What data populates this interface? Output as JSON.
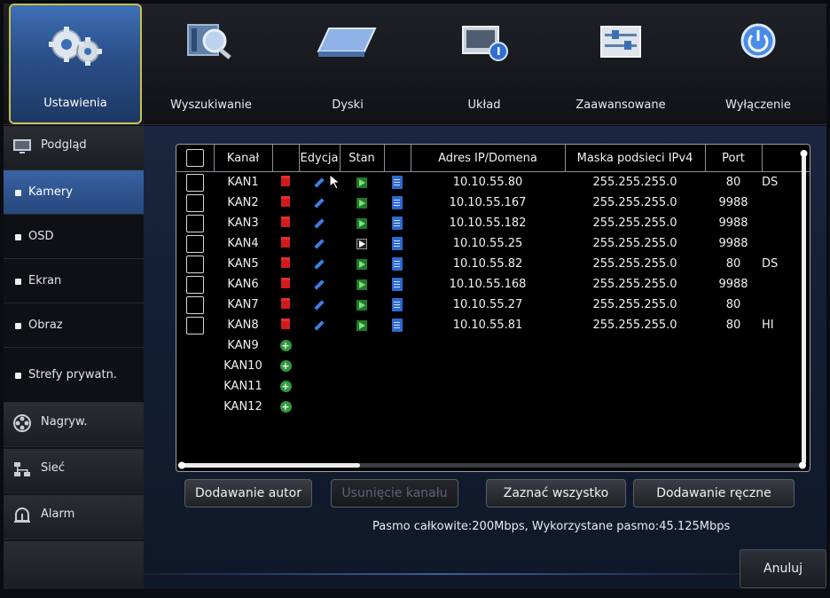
{
  "topnav": [
    {
      "label": "Ustawienia",
      "icon": "settings-gears-icon",
      "active": true
    },
    {
      "label": "Wyszukiwanie",
      "icon": "search-magnifier-icon",
      "active": false
    },
    {
      "label": "Dyski",
      "icon": "hard-disk-icon",
      "active": false
    },
    {
      "label": "Układ",
      "icon": "system-info-icon",
      "active": false
    },
    {
      "label": "Zaawansowane",
      "icon": "advanced-sliders-icon",
      "active": false
    },
    {
      "label": "Wyłączenie",
      "icon": "power-icon",
      "active": false
    }
  ],
  "sidebar": [
    {
      "label": "Podgląd",
      "type": "main",
      "icon": "monitor-icon"
    },
    {
      "label": "Kamery",
      "type": "sub",
      "active": true
    },
    {
      "label": "OSD",
      "type": "sub"
    },
    {
      "label": "Ekran",
      "type": "sub"
    },
    {
      "label": "Obraz",
      "type": "sub"
    },
    {
      "label": "Strefy prywatn.",
      "type": "sub"
    },
    {
      "label": "Nagryw.",
      "type": "main",
      "icon": "film-reel-icon"
    },
    {
      "label": "Sieć",
      "type": "main",
      "icon": "network-icon"
    },
    {
      "label": "Alarm",
      "type": "main",
      "icon": "alarm-icon"
    }
  ],
  "table": {
    "headers": [
      "Kanał",
      "Edycja",
      "Stan",
      "Adres IP/Domena",
      "Maska podsieci IPv4",
      "Port"
    ],
    "rows": [
      {
        "channel": "KAN1",
        "ip": "10.10.55.80",
        "mask": "255.255.255.0",
        "port": "80",
        "extra": "DS",
        "state": "green"
      },
      {
        "channel": "KAN2",
        "ip": "10.10.55.167",
        "mask": "255.255.255.0",
        "port": "9988",
        "extra": "",
        "state": "green"
      },
      {
        "channel": "KAN3",
        "ip": "10.10.55.182",
        "mask": "255.255.255.0",
        "port": "9988",
        "extra": "",
        "state": "green"
      },
      {
        "channel": "KAN4",
        "ip": "10.10.55.25",
        "mask": "255.255.255.0",
        "port": "9988",
        "extra": "",
        "state": "dark"
      },
      {
        "channel": "KAN5",
        "ip": "10.10.55.82",
        "mask": "255.255.255.0",
        "port": "80",
        "extra": "DS",
        "state": "green"
      },
      {
        "channel": "KAN6",
        "ip": "10.10.55.168",
        "mask": "255.255.255.0",
        "port": "9988",
        "extra": "",
        "state": "green"
      },
      {
        "channel": "KAN7",
        "ip": "10.10.55.27",
        "mask": "255.255.255.0",
        "port": "80",
        "extra": "",
        "state": "green"
      },
      {
        "channel": "KAN8",
        "ip": "10.10.55.81",
        "mask": "255.255.255.0",
        "port": "80",
        "extra": "HI",
        "state": "green"
      }
    ],
    "empty_channels": [
      "KAN9",
      "KAN10",
      "KAN11",
      "KAN12"
    ]
  },
  "buttons": {
    "auto_add": "Dodawanie autor",
    "remove_channel": "Usunięcie kanału",
    "select_all": "Zaznać wszystko",
    "manual_add": "Dodawanie ręczne",
    "cancel": "Anuluj"
  },
  "bandwidth": "Pasmo całkowite:200Mbps, Wykorzystane pasmo:45.125Mbps"
}
